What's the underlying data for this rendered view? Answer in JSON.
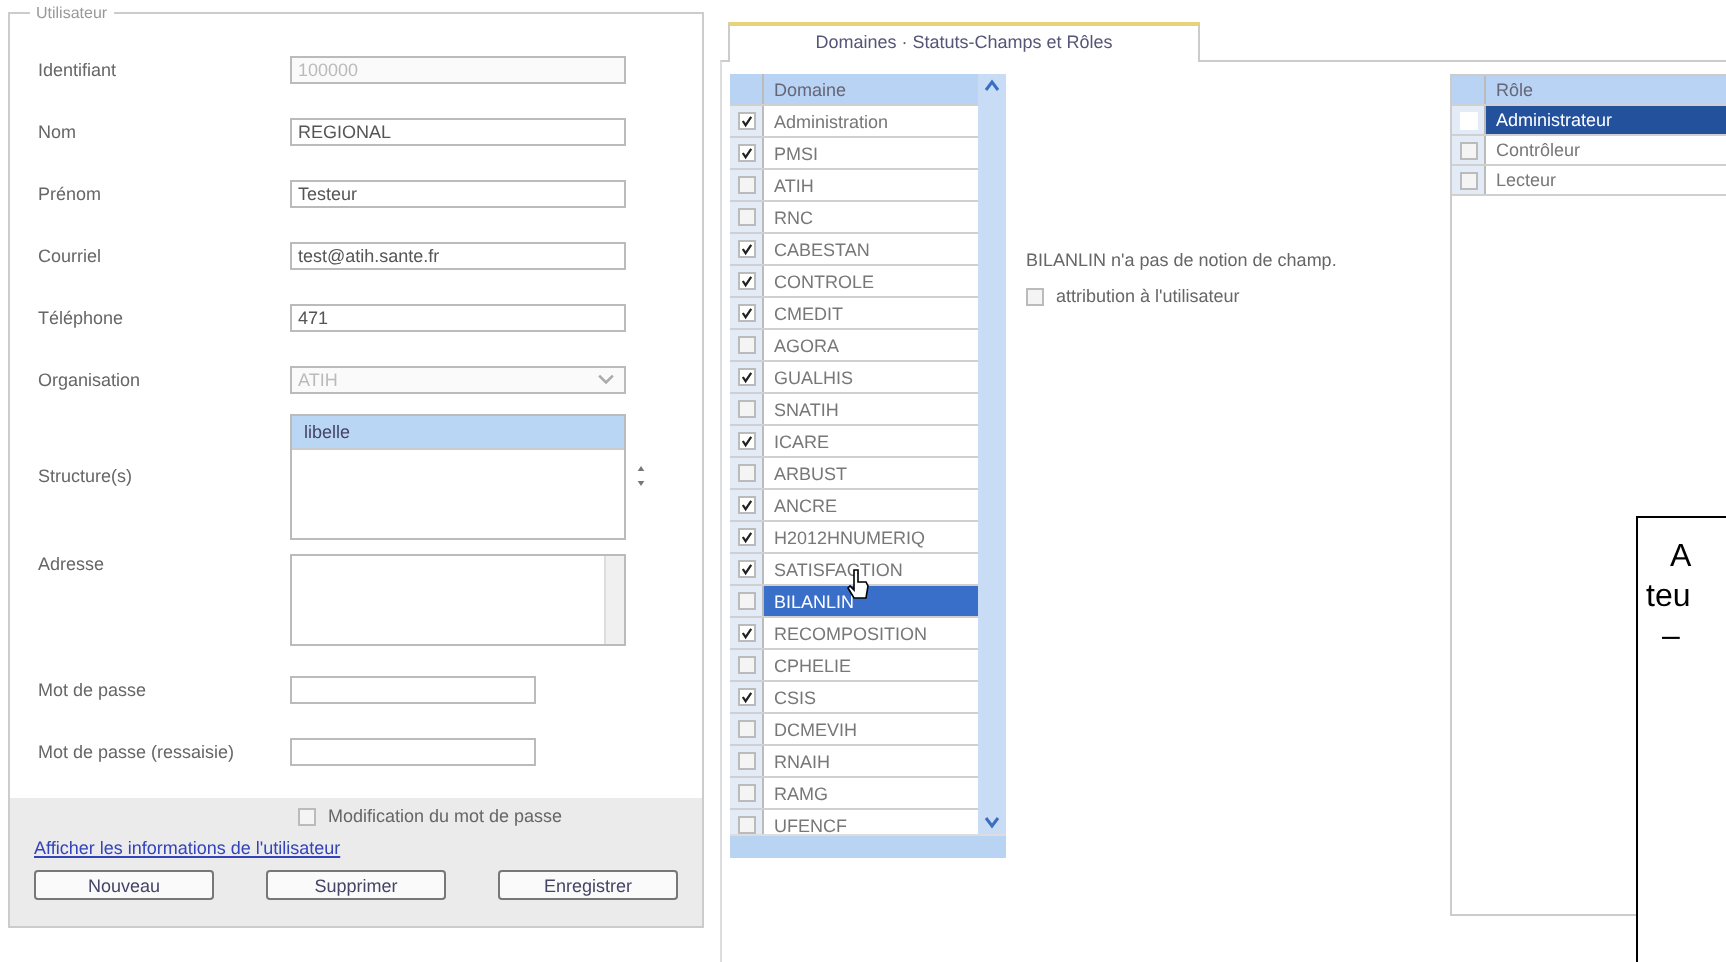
{
  "user_panel": {
    "legend": "Utilisateur",
    "fields": [
      {
        "kind": "text",
        "label": "Identifiant",
        "value": "100000",
        "disabled": true
      },
      {
        "kind": "text",
        "label": "Nom",
        "value": "REGIONAL",
        "disabled": false
      },
      {
        "kind": "text",
        "label": "Prénom",
        "value": "Testeur",
        "disabled": false
      },
      {
        "kind": "text",
        "label": "Courriel",
        "value": "test@atih.sante.fr",
        "disabled": false
      },
      {
        "kind": "text",
        "label": "Téléphone",
        "value": "471",
        "disabled": false
      },
      {
        "kind": "select",
        "label": "Organisation",
        "value": "ATIH",
        "disabled": true
      },
      {
        "kind": "list",
        "label": "Structure(s)",
        "items": [
          {
            "label": "libelle",
            "selected": true
          }
        ]
      },
      {
        "kind": "textarea",
        "label": "Adresse"
      },
      {
        "kind": "password",
        "label": "Mot de passe"
      },
      {
        "kind": "password",
        "label": "Mot de passe (ressaisie)"
      }
    ],
    "password_change": {
      "label": "Modification du mot de passe",
      "checked": false
    },
    "link": "Afficher les informations de l'utilisateur",
    "buttons": [
      "Nouveau",
      "Supprimer",
      "Enregistrer"
    ]
  },
  "tab": {
    "label": "Domaines · Statuts-Champs et Rôles",
    "selected": true
  },
  "domains": {
    "header": "Domaine",
    "rows": [
      {
        "label": "Administration",
        "checked": true,
        "selected": false
      },
      {
        "label": "PMSI",
        "checked": true,
        "selected": false
      },
      {
        "label": "ATIH",
        "checked": false,
        "selected": false
      },
      {
        "label": "RNC",
        "checked": false,
        "selected": false
      },
      {
        "label": "CABESTAN",
        "checked": true,
        "selected": false
      },
      {
        "label": "CONTROLE",
        "checked": true,
        "selected": false
      },
      {
        "label": "CMEDIT",
        "checked": true,
        "selected": false
      },
      {
        "label": "AGORA",
        "checked": false,
        "selected": false
      },
      {
        "label": "GUALHIS",
        "checked": true,
        "selected": false
      },
      {
        "label": "SNATIH",
        "checked": false,
        "selected": false
      },
      {
        "label": "ICARE",
        "checked": true,
        "selected": false
      },
      {
        "label": "ARBUST",
        "checked": false,
        "selected": false
      },
      {
        "label": "ANCRE",
        "checked": true,
        "selected": false
      },
      {
        "label": "H2012HNUMERIQ",
        "checked": true,
        "selected": false
      },
      {
        "label": "SATISFACTION",
        "checked": true,
        "selected": false
      },
      {
        "label": "BILANLIN",
        "checked": false,
        "selected": true
      },
      {
        "label": "RECOMPOSITION",
        "checked": true,
        "selected": false
      },
      {
        "label": "CPHELIE",
        "checked": false,
        "selected": false
      },
      {
        "label": "CSIS",
        "checked": true,
        "selected": false
      },
      {
        "label": "DCMEVIH",
        "checked": false,
        "selected": false
      },
      {
        "label": "RNAIH",
        "checked": false,
        "selected": false
      },
      {
        "label": "RAMG",
        "checked": false,
        "selected": false
      },
      {
        "label": "UFENCF",
        "checked": false,
        "selected": false
      }
    ]
  },
  "domain_info": {
    "message": "BILANLIN n'a pas de notion de champ.",
    "assign": {
      "label": "attribution à l'utilisateur",
      "checked": false
    }
  },
  "roles": {
    "header": "Rôle",
    "rows": [
      {
        "label": "Administrateur",
        "checked": false,
        "selected": true
      },
      {
        "label": "Contrôleur",
        "checked": false,
        "selected": false
      },
      {
        "label": "Lecteur",
        "checked": false,
        "selected": false
      }
    ]
  },
  "callout": {
    "lines": [
      "A",
      "teu",
      "–"
    ]
  }
}
